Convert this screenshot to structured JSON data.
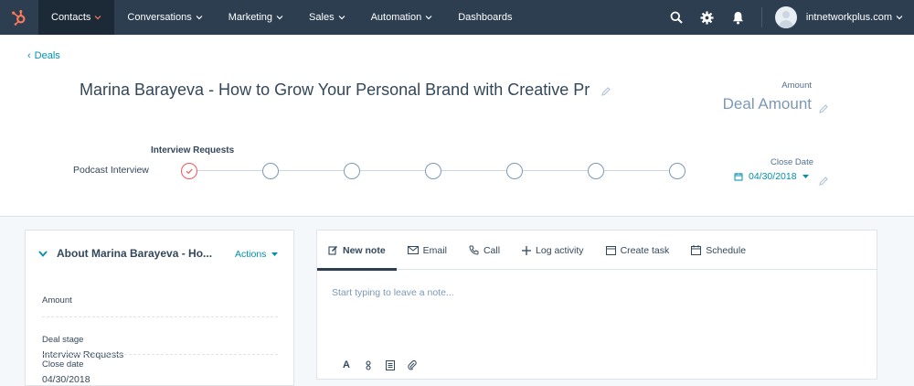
{
  "nav": {
    "items": [
      {
        "label": "Contacts",
        "has_caret": true,
        "active": true
      },
      {
        "label": "Conversations",
        "has_caret": true
      },
      {
        "label": "Marketing",
        "has_caret": true
      },
      {
        "label": "Sales",
        "has_caret": true
      },
      {
        "label": "Automation",
        "has_caret": true
      },
      {
        "label": "Dashboards",
        "has_caret": false
      }
    ],
    "account_name": "intnetworkplus.com",
    "icons": [
      "search-icon",
      "gear-icon",
      "bell-icon"
    ]
  },
  "header": {
    "back_label": "Deals",
    "deal_title": "Marina Barayeva - How to Grow Your Personal Brand with Creative Pr",
    "amount_label": "Amount",
    "amount_value": "Deal Amount",
    "pipeline_name": "Podcast Interview",
    "current_stage": "Interview Requests",
    "stage_count": 7,
    "completed_stages": 1,
    "close_date_label": "Close Date",
    "close_date_value": "04/30/2018"
  },
  "about": {
    "title": "About Marina Barayeva - Ho...",
    "actions_label": "Actions",
    "properties": [
      {
        "label": "Amount",
        "value": ""
      },
      {
        "label": "Deal stage",
        "value": "Interview Requests"
      },
      {
        "label": "Close date",
        "value": "04/30/2018"
      }
    ]
  },
  "activity": {
    "tabs": [
      {
        "label": "New note",
        "icon": "edit-icon",
        "active": true
      },
      {
        "label": "Email",
        "icon": "email-icon"
      },
      {
        "label": "Call",
        "icon": "phone-icon"
      },
      {
        "label": "Log activity",
        "icon": "plus-icon"
      },
      {
        "label": "Create task",
        "icon": "task-icon"
      },
      {
        "label": "Schedule",
        "icon": "calendar-icon"
      }
    ],
    "note_placeholder": "Start typing to leave a note...",
    "toolbar": [
      {
        "name": "text-format",
        "glyph": "A"
      },
      {
        "name": "personalize-icon"
      },
      {
        "name": "template-icon"
      },
      {
        "name": "attachment-icon"
      }
    ]
  },
  "colors": {
    "nav_bg": "#2d3e50",
    "nav_active_bg": "#1c2a38",
    "brand_orange": "#ff7a59",
    "link": "#0091ae",
    "text": "#33475b",
    "muted": "#7c98b6"
  }
}
